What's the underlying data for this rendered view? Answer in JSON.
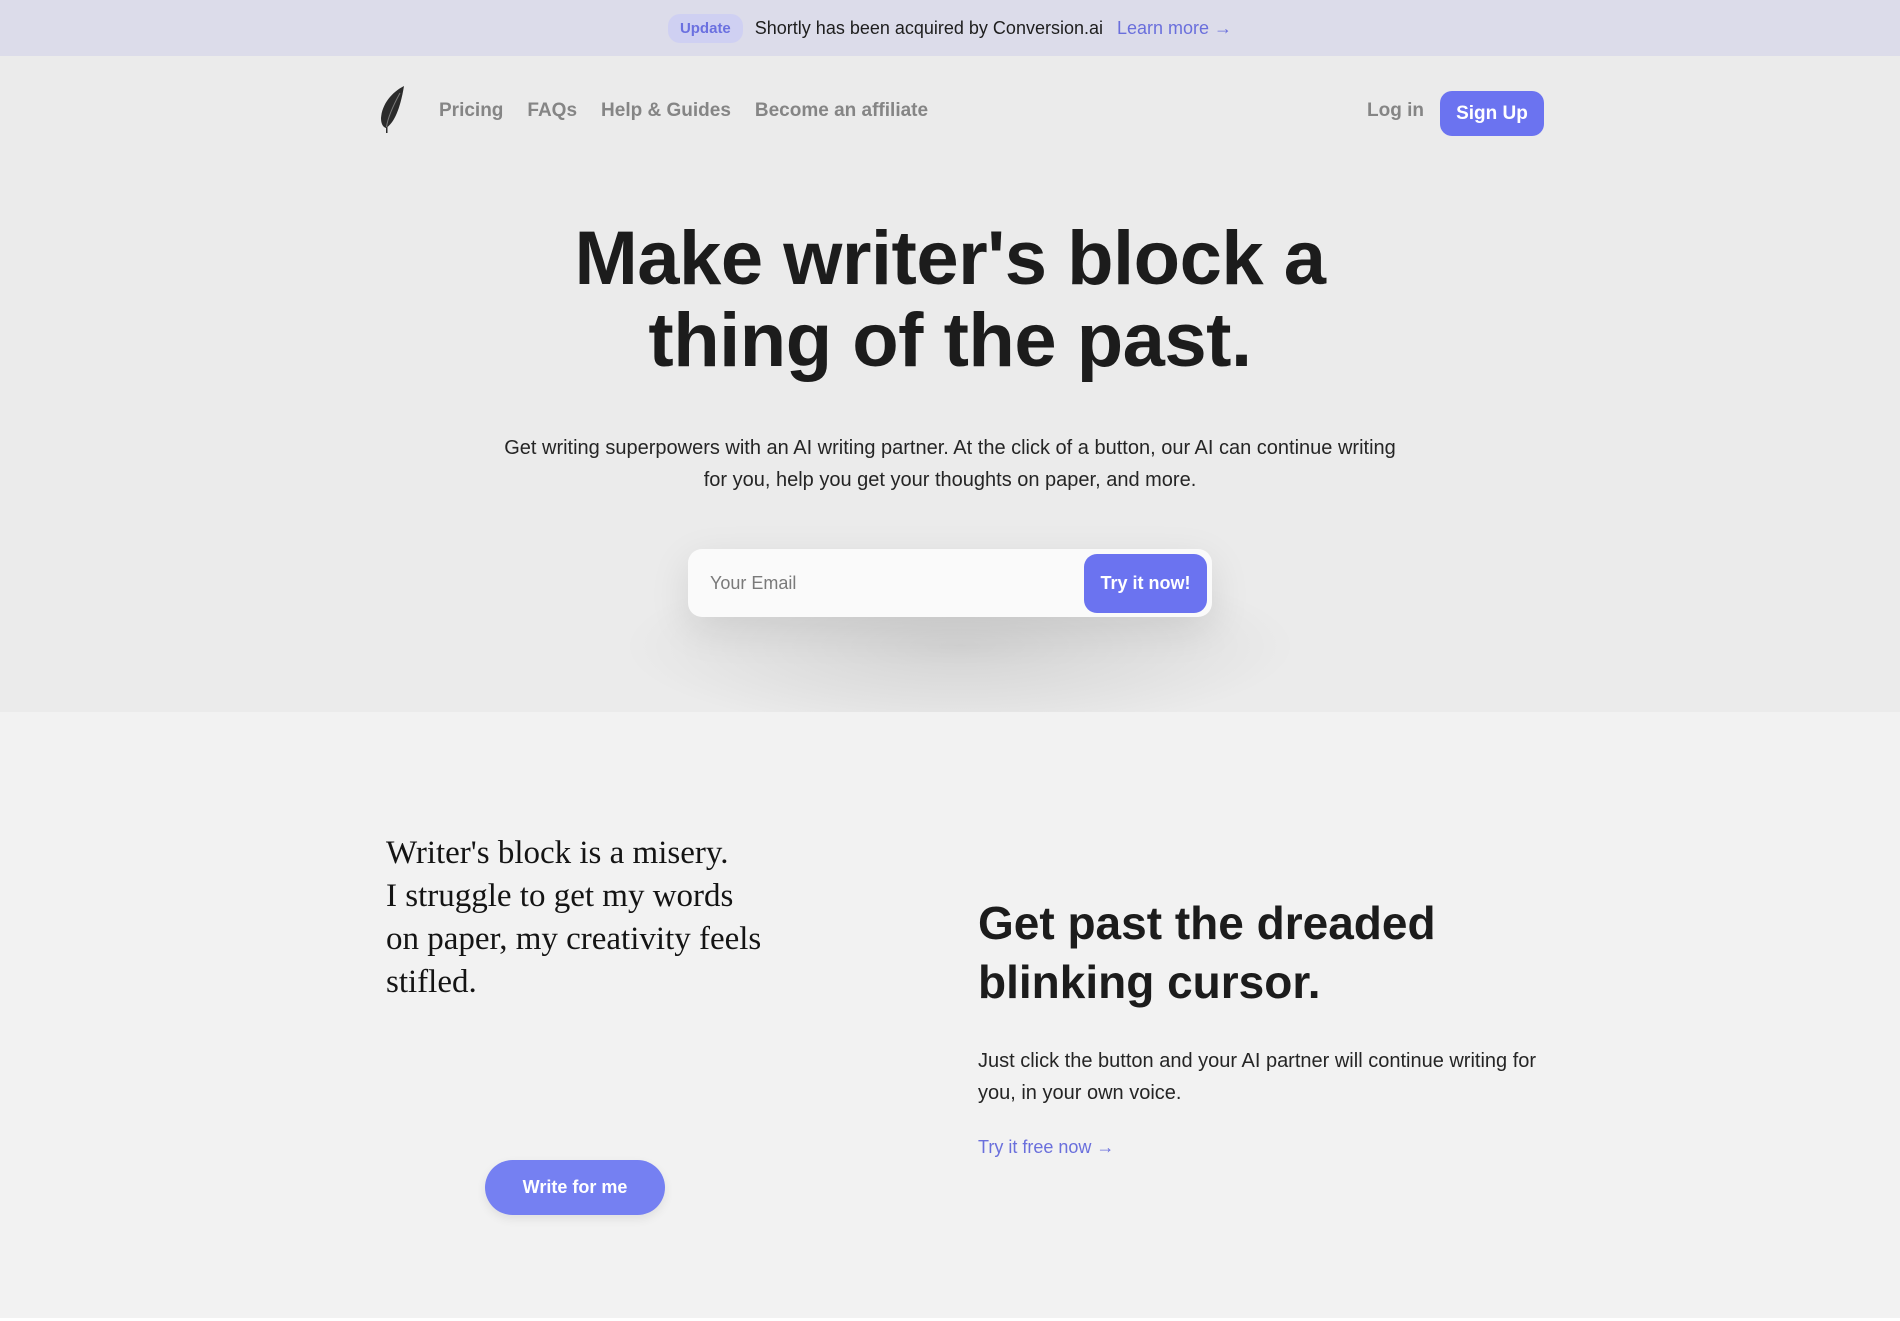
{
  "announcement": {
    "badge": "Update",
    "message": "Shortly has been acquired by Conversion.ai",
    "link": "Learn more →"
  },
  "nav": {
    "logo_icon": "feather-icon",
    "links": [
      "Pricing",
      "FAQs",
      "Help & Guides",
      "Become an affiliate"
    ],
    "login": "Log in",
    "signup": "Sign Up"
  },
  "hero": {
    "title_line1": "Make writer's block a",
    "title_line2": "thing of the past.",
    "subtitle": "Get writing superpowers with an AI writing partner. At the click of a button, our AI can continue writing for you, help you get your thoughts on paper, and more.",
    "email_placeholder": "Your Email",
    "email_value": "",
    "cta_button": "Try it now!"
  },
  "feature": {
    "quote_lines": [
      "Writer's block is a misery.",
      "I struggle to get my words",
      "on paper, my creativity feels",
      "stifled."
    ],
    "write_button": "Write for me",
    "title_line1": "Get past the dreaded",
    "title_line2": "blinking cursor.",
    "body": "Just click the button and your AI partner will continue writing for you, in your own voice.",
    "link": "Try it free now →"
  },
  "colors": {
    "accent": "#6b73f0",
    "link": "#6a6fdc",
    "announce_bg": "#dcdcea",
    "hero_bg": "#ebebeb",
    "feature_bg": "#f2f2f2",
    "text": "#1c1c1c"
  }
}
